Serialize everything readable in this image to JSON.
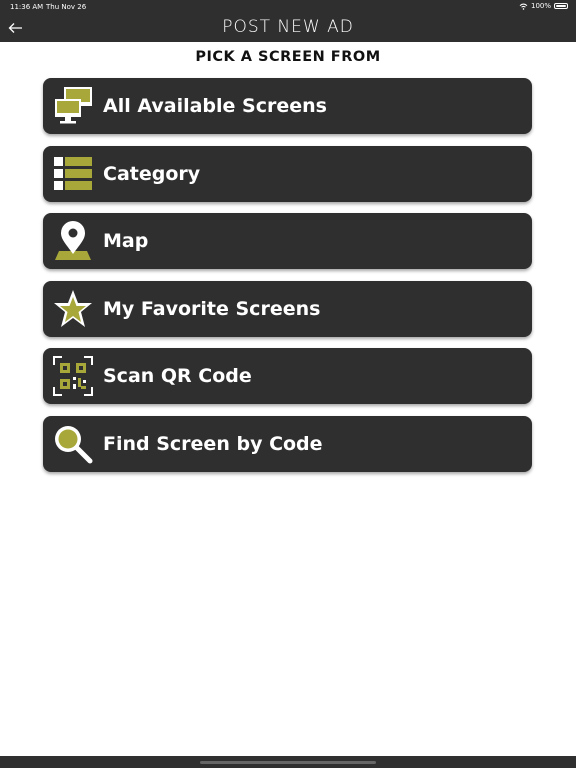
{
  "status_bar": {
    "time": "11:36 AM",
    "date": "Thu Nov 26",
    "battery": "100%"
  },
  "nav": {
    "title": "POST NEW AD",
    "back_icon": "arrow-left-icon"
  },
  "subtitle": "PICK A SCREEN FROM",
  "accent_color": "#a8a83a",
  "menu": [
    {
      "label": "All Available Screens",
      "icon": "monitors-icon"
    },
    {
      "label": "Category",
      "icon": "category-list-icon"
    },
    {
      "label": "Map",
      "icon": "map-pin-icon"
    },
    {
      "label": "My Favorite Screens",
      "icon": "star-icon"
    },
    {
      "label": "Scan QR Code",
      "icon": "qr-code-icon"
    },
    {
      "label": "Find Screen by Code",
      "icon": "magnifier-icon"
    }
  ]
}
